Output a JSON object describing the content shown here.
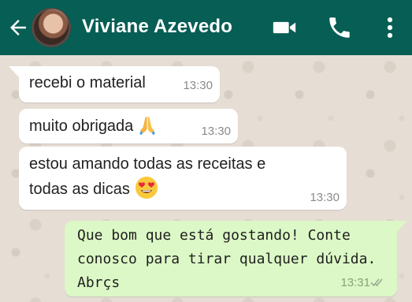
{
  "header": {
    "contact_name": "Viviane Azevedo",
    "icons": [
      "back-arrow-icon",
      "avatar",
      "video-call-icon",
      "phone-icon",
      "more-options-icon"
    ]
  },
  "colors": {
    "header_bg": "#075e54",
    "incoming_bubble": "#ffffff",
    "outgoing_bubble": "#dcf8c6",
    "wallpaper": "#e6ded5"
  },
  "messages": [
    {
      "direction": "incoming",
      "text": "recebi o material",
      "time": "13:30"
    },
    {
      "direction": "incoming",
      "text": "muito obrigada",
      "emoji": "folded-hands-emoji",
      "time": "13:30"
    },
    {
      "direction": "incoming",
      "lines": [
        "estou amando todas as receitas e",
        "todas as dicas"
      ],
      "emoji": "heart-eyes-emoji",
      "time": "13:30"
    },
    {
      "direction": "outgoing",
      "lines": [
        "Que bom que está gostando! Conte",
        "conosco para tirar qualquer dúvida.",
        "Abrçs"
      ],
      "time": "13:31",
      "status": "read-ticks-icon"
    }
  ]
}
